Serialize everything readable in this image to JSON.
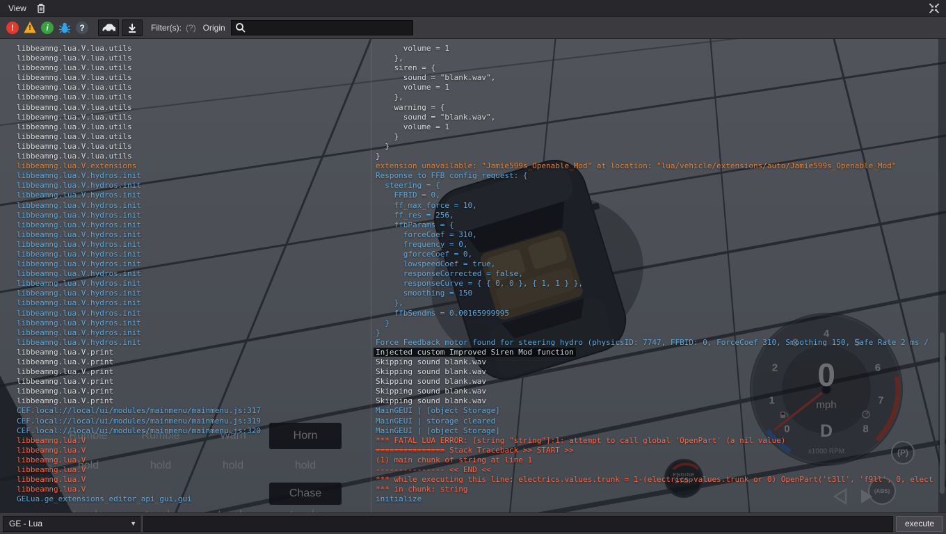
{
  "titlebar": {
    "view_menu": "View"
  },
  "toolbar": {
    "filters_label": "Filter(s):",
    "filters_hint": "(?)",
    "origin_label": "Origin",
    "search_value": "",
    "glyphs": {
      "error": "!",
      "warning": "!",
      "info": "i",
      "unknown": "?"
    }
  },
  "console": {
    "rows": [
      [
        "libbeamng.lua.V.lua.utils",
        "      volume = 1",
        "info"
      ],
      [
        "libbeamng.lua.V.lua.utils",
        "    },",
        "info"
      ],
      [
        "libbeamng.lua.V.lua.utils",
        "    siren = {",
        "info"
      ],
      [
        "libbeamng.lua.V.lua.utils",
        "      sound = \"blank.wav\",",
        "info"
      ],
      [
        "libbeamng.lua.V.lua.utils",
        "      volume = 1",
        "info"
      ],
      [
        "libbeamng.lua.V.lua.utils",
        "    },",
        "info"
      ],
      [
        "libbeamng.lua.V.lua.utils",
        "    warning = {",
        "info"
      ],
      [
        "libbeamng.lua.V.lua.utils",
        "      sound = \"blank.wav\",",
        "info"
      ],
      [
        "libbeamng.lua.V.lua.utils",
        "      volume = 1",
        "info"
      ],
      [
        "libbeamng.lua.V.lua.utils",
        "    }",
        "info"
      ],
      [
        "libbeamng.lua.V.lua.utils",
        "  }",
        "info"
      ],
      [
        "libbeamng.lua.V.lua.utils",
        "}",
        "info"
      ],
      [
        "libbeamng.lua.V.extensions",
        "extension unavailable: \"Jamie599s_Openable_Mod\" at location: \"lua/vehicle/extensions/auto/Jamie599s_Openable_Mod\"",
        "warn"
      ],
      [
        "libbeamng.lua.V.hydros.init",
        "Response to FFB config request: {",
        "debug"
      ],
      [
        "libbeamng.lua.V.hydros.init",
        "  steering = {",
        "debug"
      ],
      [
        "libbeamng.lua.V.hydros.init",
        "    FFBID = 0,",
        "debug"
      ],
      [
        "libbeamng.lua.V.hydros.init",
        "    ff_max_force = 10,",
        "debug"
      ],
      [
        "libbeamng.lua.V.hydros.init",
        "    ff_res = 256,",
        "debug"
      ],
      [
        "libbeamng.lua.V.hydros.init",
        "    ffbParams = {",
        "debug"
      ],
      [
        "libbeamng.lua.V.hydros.init",
        "      forceCoef = 310,",
        "debug"
      ],
      [
        "libbeamng.lua.V.hydros.init",
        "      frequency = 0,",
        "debug"
      ],
      [
        "libbeamng.lua.V.hydros.init",
        "      gforceCoef = 0,",
        "debug"
      ],
      [
        "libbeamng.lua.V.hydros.init",
        "      lowspeedCoef = true,",
        "debug"
      ],
      [
        "libbeamng.lua.V.hydros.init",
        "      responseCorrected = false,",
        "debug"
      ],
      [
        "libbeamng.lua.V.hydros.init",
        "      responseCurve = { { 0, 0 }, { 1, 1 } },",
        "debug"
      ],
      [
        "libbeamng.lua.V.hydros.init",
        "      smoothing = 150",
        "debug"
      ],
      [
        "libbeamng.lua.V.hydros.init",
        "    },",
        "debug"
      ],
      [
        "libbeamng.lua.V.hydros.init",
        "    ffbSendms = 0.00165999995",
        "debug"
      ],
      [
        "libbeamng.lua.V.hydros.init",
        "  }",
        "debug"
      ],
      [
        "libbeamng.lua.V.hydros.init",
        "}",
        "debug"
      ],
      [
        "libbeamng.lua.V.hydros.init",
        "Force Feedback motor found for steering hydro (physicsID: 7747, FFBID: 0, ForceCoef 310, Smoothing 150, Safe Rate 2 ms /",
        "debug"
      ],
      [
        "libbeamng.lua.V.print",
        "Injected custom Improved Siren Mod function",
        "info",
        true
      ],
      [
        "libbeamng.lua.V.print",
        "Skipping sound blank.wav",
        "info"
      ],
      [
        "libbeamng.lua.V.print",
        "Skipping sound blank.wav",
        "info"
      ],
      [
        "libbeamng.lua.V.print",
        "Skipping sound blank.wav",
        "info"
      ],
      [
        "libbeamng.lua.V.print",
        "Skipping sound blank.wav",
        "info"
      ],
      [
        "libbeamng.lua.V.print",
        "Skipping sound blank.wav",
        "info"
      ],
      [
        "CEF.local://local/ui/modules/mainmenu/mainmenu.js:317",
        "MainGEUI | [object Storage]",
        "debug"
      ],
      [
        "CEF.local://local/ui/modules/mainmenu/mainmenu.js:319",
        "MainGEUI | storage cleared",
        "debug"
      ],
      [
        "CEF.local://local/ui/modules/mainmenu/mainmenu.js:320",
        "MainGEUI | [object Storage]",
        "debug"
      ],
      [
        "libbeamng.lua.V",
        "*** FATAL LUA ERROR: [string \"string\"]:1: attempt to call global 'OpenPart' (a nil value)",
        "error"
      ],
      [
        "libbeamng.lua.V",
        "=============== Stack Traceback >> START >>",
        "error"
      ],
      [
        "libbeamng.lua.V",
        "(1) main chunk of string at line 1",
        "error"
      ],
      [
        "libbeamng.lua.V",
        "--------------- << END <<",
        "error"
      ],
      [
        "libbeamng.lua.V",
        "*** while executing this line: electrics.values.trunk = 1-(electrics.values.trunk or 0) OpenPart('t3ll', 'f9ll', 0, elect",
        "error"
      ],
      [
        "libbeamng.lua.V",
        "*** in chunk: string",
        "error"
      ],
      [
        "GELua.ge_extensions_editor_api_gui.gui",
        "initialize",
        "debug"
      ]
    ]
  },
  "bottombar": {
    "mode_selector": "GE - Lua",
    "caret": "▼",
    "command_value": "",
    "execute_label": "execute"
  },
  "background": {
    "gauge": {
      "speed": "0",
      "unit": "mph",
      "gear": "D",
      "rpm_label": "x1000 RPM",
      "ticks": [
        "0",
        "1",
        "2",
        "3",
        "4",
        "5",
        "6",
        "7",
        "8"
      ],
      "park": "(P)",
      "abs": "(ABS)"
    },
    "engine_button": {
      "line1": "ENGINE",
      "line2": "STOP"
    },
    "controls": {
      "rows": [
        [
          "Rumble",
          "Rumble",
          "Warn",
          "Horn"
        ],
        [
          "hold",
          "hold",
          "hold",
          "hold"
        ],
        [
          "",
          "",
          "",
          "Chase"
        ],
        [
          "toggle",
          "toggle",
          "toggle",
          "toggle"
        ]
      ],
      "dark_cells": [
        [
          0,
          3
        ],
        [
          2,
          3
        ]
      ]
    }
  },
  "colors": {
    "info": "#d6d6d6",
    "debug": "#5ea7da",
    "warn": "#e08138",
    "error": "#ff6340",
    "accent_red": "#e23b2e",
    "accent_yellow": "#f2a81d",
    "accent_green": "#38a33c",
    "accent_blue": "#35a3e8"
  }
}
